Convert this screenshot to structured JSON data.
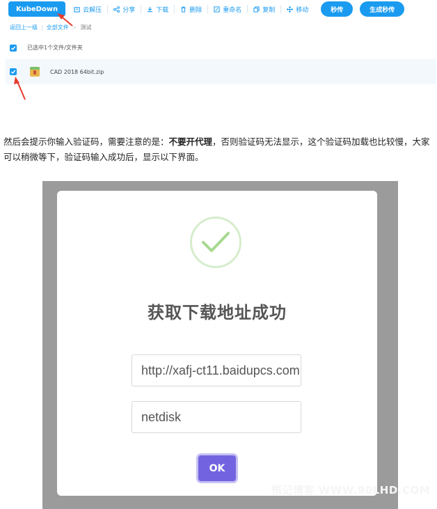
{
  "toolbar": {
    "brand": "KubeDown",
    "tools": [
      {
        "label": "云解压",
        "icon": "archive-icon"
      },
      {
        "label": "分享",
        "icon": "share-icon"
      },
      {
        "label": "下载",
        "icon": "download-icon"
      },
      {
        "label": "删除",
        "icon": "trash-icon"
      },
      {
        "label": "重命名",
        "icon": "rename-icon"
      },
      {
        "label": "复制",
        "icon": "copy-icon"
      },
      {
        "label": "移动",
        "icon": "move-icon"
      }
    ],
    "instant_upload": "秒传",
    "generate_instant_upload": "生成秒传"
  },
  "breadcrumb": {
    "back": "返回上一级",
    "all_files": "全部文件",
    "separator": ">",
    "current": "测试"
  },
  "selection_info": "已选中1个文件/文件夹",
  "file": {
    "name": "CAD 2018 64bit.zip",
    "icon": "zip-file-icon"
  },
  "paragraph": {
    "part1": "然后会提示你输入验证码，需要注意的是：",
    "bold": "不要开代理",
    "part2": "，否则验证码无法显示，这个验证码加载也比较慢，大家可以稍微等下，验证码输入成功后，显示以下界面。"
  },
  "modal": {
    "title": "获取下载地址成功",
    "url_value": "http://xafj-ct11.baidupcs.com",
    "ua_value": "netdisk",
    "ok": "OK"
  },
  "watermark": "悟记博客 WWW.90LHD.COM",
  "colors": {
    "accent": "#1a9bf0",
    "annotation_arrow": "#e63b2e",
    "ok_button": "#7264e0",
    "success": "#a6d98f",
    "overlay": "#9b9b9b"
  }
}
